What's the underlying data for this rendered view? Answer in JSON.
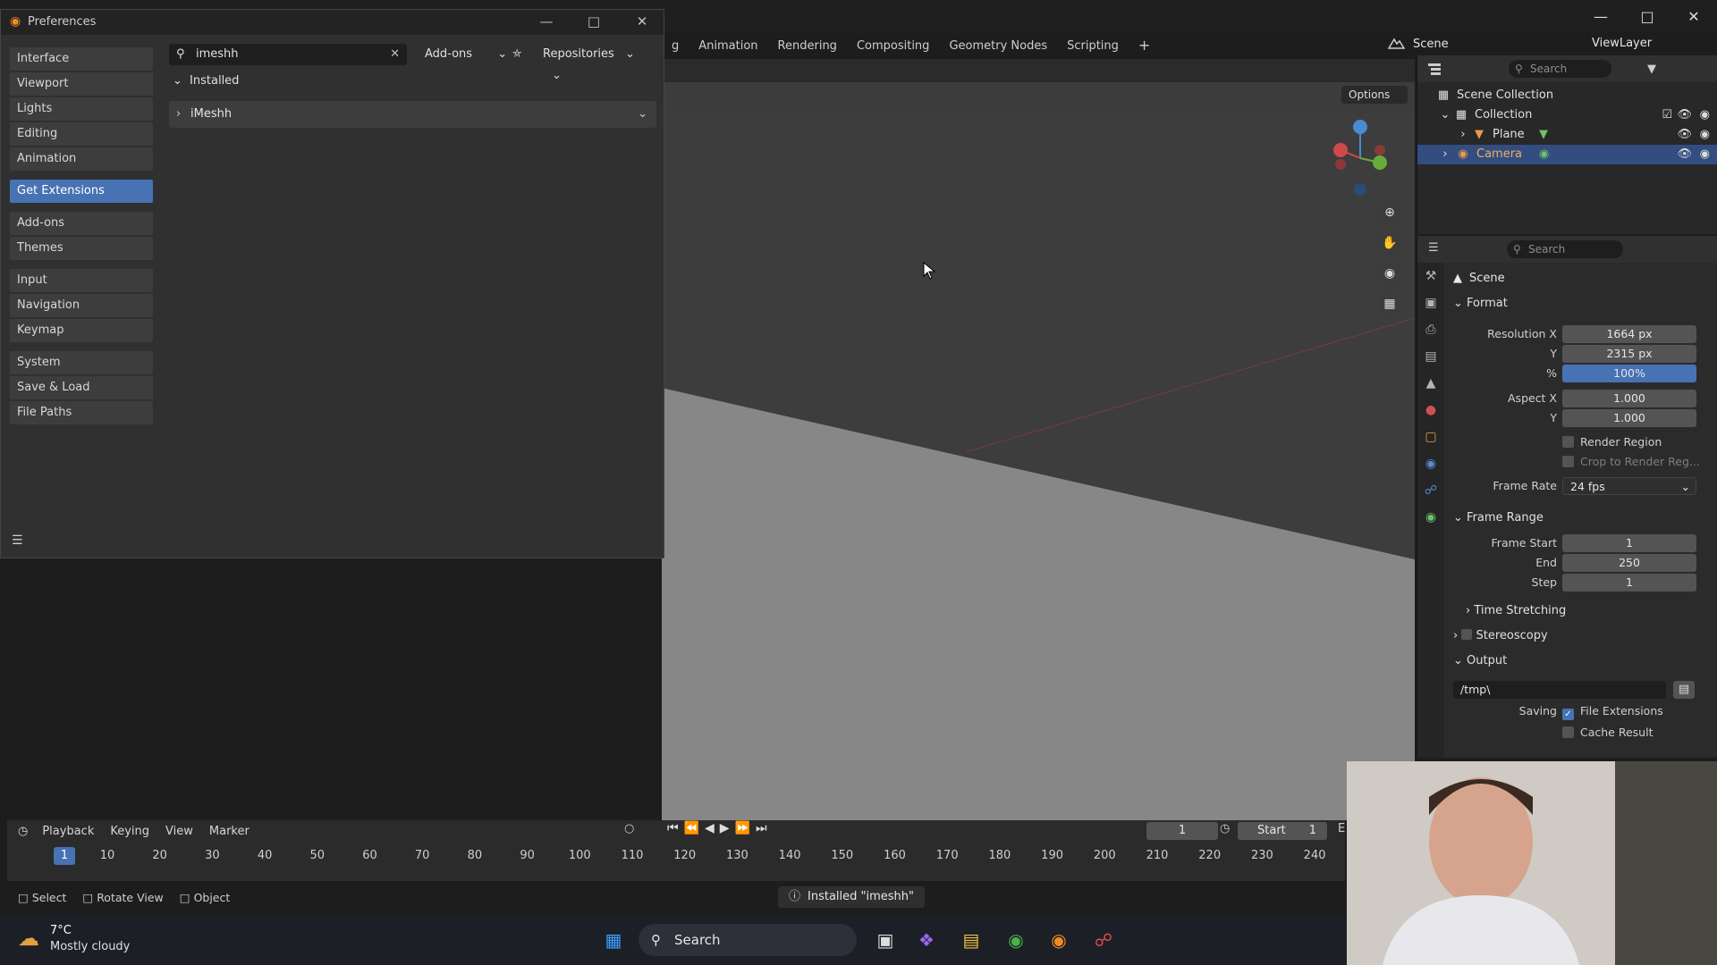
{
  "main": {
    "workspace_tabs": [
      "g",
      "Animation",
      "Rendering",
      "Compositing",
      "Geometry Nodes",
      "Scripting",
      "+"
    ],
    "scene_name": "Scene",
    "view_layer": "ViewLayer",
    "viewport_options": "Options"
  },
  "outliner": {
    "search_placeholder": "Search",
    "rows": [
      {
        "label": "Scene Collection"
      },
      {
        "label": "Collection"
      },
      {
        "label": "Plane"
      },
      {
        "label": "Camera"
      }
    ]
  },
  "properties": {
    "search_placeholder": "Search",
    "title": "Scene",
    "format": {
      "header": "Format",
      "resolution_x_label": "Resolution X",
      "resolution_x": "1664 px",
      "y_label": "Y",
      "resolution_y": "2315 px",
      "pct_label": "%",
      "resolution_pct": "100%",
      "aspect_x_label": "Aspect X",
      "aspect_x": "1.000",
      "aspect_y_label": "Y",
      "aspect_y": "1.000",
      "render_region": "Render Region",
      "crop_region": "Crop to Render Reg...",
      "frame_rate_label": "Frame Rate",
      "frame_rate": "24 fps"
    },
    "frame_range": {
      "header": "Frame Range",
      "start_label": "Frame Start",
      "start": "1",
      "end_label": "End",
      "end": "250",
      "step_label": "Step",
      "step": "1"
    },
    "time_stretching": "Time Stretching",
    "stereoscopy": "Stereoscopy",
    "output": {
      "header": "Output",
      "path": "/tmp\\",
      "saving_label": "Saving",
      "file_extensions": "File Extensions",
      "cache_result": "Cache Result"
    }
  },
  "timeline": {
    "menus": [
      "Playback",
      "Keying",
      "View",
      "Marker"
    ],
    "current_frame": "1",
    "ruler": [
      "10",
      "20",
      "30",
      "40",
      "50",
      "60",
      "70",
      "80",
      "90",
      "100",
      "110",
      "120",
      "130",
      "140",
      "150",
      "160",
      "170",
      "180",
      "190",
      "200",
      "210",
      "220",
      "230",
      "240"
    ],
    "frame_field": "1",
    "start_label": "Start",
    "start_value": "1",
    "end_abbr": "E"
  },
  "statusbar": {
    "select": "Select",
    "rotate": "Rotate View",
    "object": "Object",
    "message": "Installed \"imeshh\""
  },
  "taskbar": {
    "temperature": "7°C",
    "weather": "Mostly cloudy",
    "search": "Search"
  },
  "preferences": {
    "title": "Preferences",
    "sidebar": [
      [
        "Interface",
        "Viewport",
        "Lights",
        "Editing",
        "Animation"
      ],
      [
        "Get Extensions"
      ],
      [
        "Add-ons",
        "Themes"
      ],
      [
        "Input",
        "Navigation",
        "Keymap"
      ],
      [
        "System",
        "Save & Load",
        "File Paths"
      ]
    ],
    "search_value": "imeshh",
    "addons_dropdown": "Add-ons",
    "repositories_dropdown": "Repositories",
    "installed_section": "Installed",
    "extension_name": "iMeshh"
  }
}
